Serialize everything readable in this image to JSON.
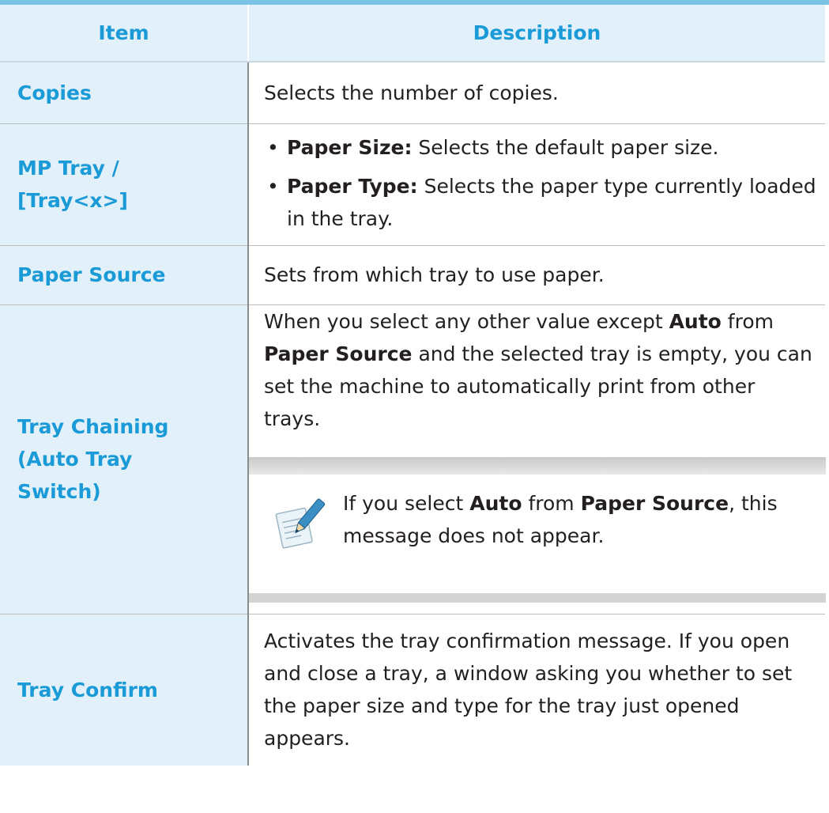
{
  "header": {
    "item": "Item",
    "description": "Description"
  },
  "rows": {
    "copies": {
      "item": "Copies",
      "desc": "Selects the number of copies."
    },
    "mp_tray": {
      "item_line1": "MP Tray /",
      "item_line2": "[Tray<x>]",
      "bullets": [
        {
          "label": "Paper Size:",
          "text": " Selects the default paper size."
        },
        {
          "label": "Paper Type:",
          "text": " Selects the paper type currently loaded in the tray."
        }
      ]
    },
    "paper_source": {
      "item": "Paper Source",
      "desc": "Sets from which tray to use paper."
    },
    "tray_chaining": {
      "item_line1": "Tray Chaining",
      "item_line2": "(Auto Tray",
      "item_line3": "Switch)",
      "desc_part1": "When you select any other value except ",
      "desc_bold1": "Auto",
      "desc_part2": " from ",
      "desc_bold2": "Paper Source",
      "desc_part3": " and the selected tray is empty, you can set the machine to automatically print from other trays.",
      "note": {
        "icon": "note-pencil-icon",
        "part1": "If you select ",
        "bold1": "Auto",
        "part2": " from ",
        "bold2": "Paper Source",
        "part3": ", this message does not appear."
      }
    },
    "tray_confirm": {
      "item": "Tray Confirm",
      "desc": "Activates the tray confirmation message. If you open and close a tray, a window asking you whether to set the paper size and type for the tray just opened appears."
    }
  },
  "colors": {
    "accent": "#1a9ad6",
    "header_bg": "#e1f0f9",
    "top_rule": "#7bc3e4"
  }
}
